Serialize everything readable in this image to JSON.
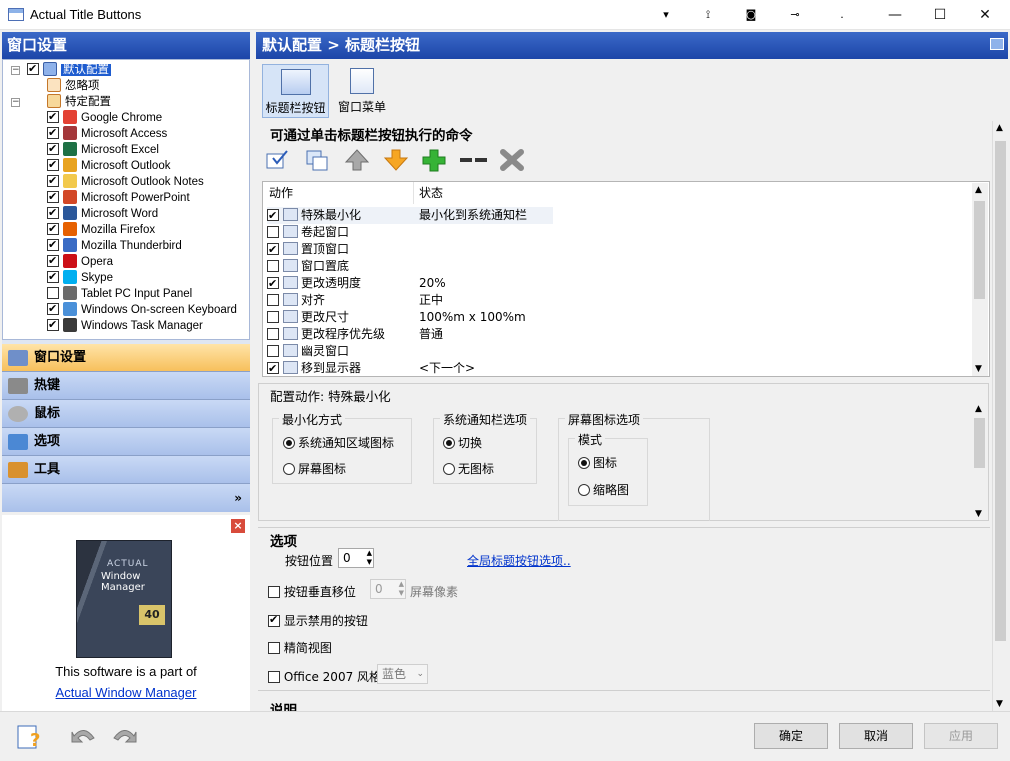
{
  "window": {
    "title": "Actual Title Buttons"
  },
  "titlebar": {
    "extra_buttons": [
      "▾",
      "⟟",
      "◙",
      "⊸",
      "."
    ],
    "minimize": "—",
    "maximize": "☐",
    "close": "✕"
  },
  "left": {
    "header": "窗口设置",
    "tree": {
      "default": "默认配置",
      "ignored": "忽略项",
      "specific": "特定配置",
      "apps": [
        {
          "label": "Google Chrome",
          "checked": true,
          "color": "#e34133"
        },
        {
          "label": "Microsoft Access",
          "checked": true,
          "color": "#a4373a"
        },
        {
          "label": "Microsoft Excel",
          "checked": true,
          "color": "#1e7145"
        },
        {
          "label": "Microsoft Outlook",
          "checked": true,
          "color": "#e8a320"
        },
        {
          "label": "Microsoft Outlook Notes",
          "checked": true,
          "color": "#f2c94c"
        },
        {
          "label": "Microsoft PowerPoint",
          "checked": true,
          "color": "#d24726"
        },
        {
          "label": "Microsoft Word",
          "checked": true,
          "color": "#2b579a"
        },
        {
          "label": "Mozilla Firefox",
          "checked": true,
          "color": "#e66000"
        },
        {
          "label": "Mozilla Thunderbird",
          "checked": true,
          "color": "#3a6bc4"
        },
        {
          "label": "Opera",
          "checked": true,
          "color": "#cc0f16"
        },
        {
          "label": "Skype",
          "checked": true,
          "color": "#00aff0"
        },
        {
          "label": "Tablet PC Input Panel",
          "checked": false,
          "color": "#6b6b6b"
        },
        {
          "label": "Windows On-screen Keyboard",
          "checked": true,
          "color": "#4a90d9"
        },
        {
          "label": "Windows Task Manager",
          "checked": true,
          "color": "#3a3a3a"
        }
      ]
    },
    "nav": [
      {
        "label": "窗口设置",
        "active": true
      },
      {
        "label": "热键",
        "active": false
      },
      {
        "label": "鼠标",
        "active": false
      },
      {
        "label": "选项",
        "active": false
      },
      {
        "label": "工具",
        "active": false
      }
    ],
    "nav_more": "»",
    "ad": {
      "box_brand": "ACTUAL",
      "box_title": "Window Manager",
      "box_badge": "40",
      "text": "This software is a part of",
      "link": "Actual Window Manager"
    }
  },
  "right": {
    "header": "默认配置 > 标题栏按钮",
    "tabs": [
      "标题栏按钮",
      "窗口菜单"
    ],
    "commands_title": "可通过单击标题栏按钮执行的命令",
    "list_headers": {
      "action": "动作",
      "state": "状态"
    },
    "commands": [
      {
        "label": "特殊最小化",
        "state": "最小化到系统通知栏",
        "checked": true
      },
      {
        "label": "卷起窗口",
        "state": "",
        "checked": false
      },
      {
        "label": "置顶窗口",
        "state": "",
        "checked": true
      },
      {
        "label": "窗口置底",
        "state": "",
        "checked": false
      },
      {
        "label": "更改透明度",
        "state": "20%",
        "checked": true
      },
      {
        "label": "对齐",
        "state": "正中",
        "checked": false
      },
      {
        "label": "更改尺寸",
        "state": "100%m x 100%m",
        "checked": false
      },
      {
        "label": "更改程序优先级",
        "state": "普通",
        "checked": false
      },
      {
        "label": "幽灵窗口",
        "state": "",
        "checked": false
      },
      {
        "label": "移到显示器",
        "state": "<下一个>",
        "checked": true
      }
    ],
    "config_title": "配置动作: 特殊最小化",
    "minimize_mode": {
      "legend": "最小化方式",
      "options": [
        "系统通知区域图标",
        "屏幕图标"
      ],
      "selected": 0
    },
    "tray_options": {
      "legend": "系统通知栏选项",
      "options": [
        "切换",
        "无图标"
      ],
      "selected": 0
    },
    "screen_icon_options": {
      "legend": "屏幕图标选项",
      "mode_legend": "模式",
      "options": [
        "图标",
        "缩略图"
      ],
      "selected": 0
    },
    "options": {
      "title": "选项",
      "button_position_label": "按钮位置",
      "button_position_value": "0",
      "global_link": "全局标题按钮选项..",
      "vertical_offset_label": "按钮垂直移位",
      "vertical_offset_value": "0",
      "vertical_offset_unit": "屏幕像素",
      "vertical_offset_checked": false,
      "show_disabled_label": "显示禁用的按钮",
      "show_disabled_checked": true,
      "compact_label": "精简视图",
      "compact_checked": false,
      "office_label": "Office 2007 风格",
      "office_checked": false,
      "office_color": "蓝色"
    },
    "description_title": "说明"
  },
  "footer": {
    "ok": "确定",
    "cancel": "取消",
    "apply": "应用"
  }
}
